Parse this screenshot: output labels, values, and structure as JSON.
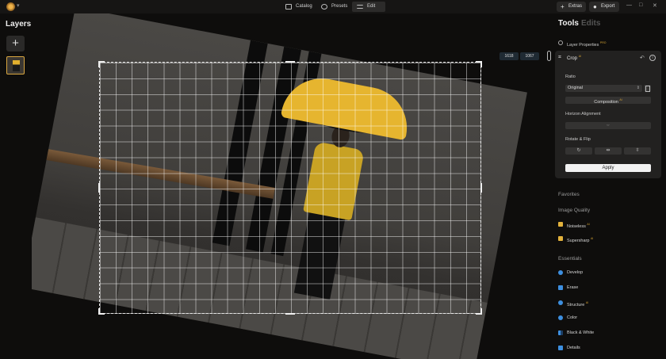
{
  "topbar": {
    "tabs": [
      {
        "label": "Catalog"
      },
      {
        "label": "Presets"
      },
      {
        "label": "Edit"
      }
    ],
    "extras_label": "Extras",
    "export_label": "Export",
    "window_controls": [
      "—",
      "□",
      "✕"
    ]
  },
  "layers": {
    "title": "Layers",
    "add_symbol": "+"
  },
  "canvas": {
    "width_value": "1618",
    "height_value": "1067"
  },
  "tools_panel": {
    "tools_title": "Tools",
    "edits_title": "Edits",
    "layer_properties": "Layer Properties",
    "layer_properties_badge": "PRO",
    "crop": {
      "title": "Crop",
      "badge": "AI",
      "ratio_label": "Ratio",
      "ratio_value": "Original",
      "composition_label": "Composition",
      "composition_badge": "AI",
      "horizon_label": "Horizon Alignment",
      "horizon_symbol": "⇔",
      "rotate_flip_label": "Rotate & Flip",
      "rotate_symbols": [
        "↻",
        "⇹",
        "⇳"
      ],
      "apply_label": "Apply"
    },
    "favorites_title": "Favorites",
    "image_quality_title": "Image Quality",
    "image_quality_items": [
      {
        "label": "Noiseless",
        "badge": "AI",
        "icon": "noiseless-icon",
        "color": "#e3b23c"
      },
      {
        "label": "Supersharp",
        "badge": "AI",
        "icon": "supersharp-icon",
        "color": "#e3b23c"
      }
    ],
    "essentials_title": "Essentials",
    "essentials_items": [
      {
        "label": "Develop",
        "badge": "",
        "icon": "develop-icon",
        "color": "#3d8fe0"
      },
      {
        "label": "Erase",
        "badge": "",
        "icon": "erase-icon",
        "color": "#3d8fe0"
      },
      {
        "label": "Structure",
        "badge": "AI",
        "icon": "structure-icon",
        "color": "#3d8fe0"
      },
      {
        "label": "Color",
        "badge": "",
        "icon": "color-icon",
        "color": "#3d8fe0"
      },
      {
        "label": "Black & White",
        "badge": "",
        "icon": "black-white-icon",
        "color": "#3d8fe0"
      },
      {
        "label": "Details",
        "badge": "",
        "icon": "details-icon",
        "color": "#3d8fe0"
      }
    ]
  }
}
